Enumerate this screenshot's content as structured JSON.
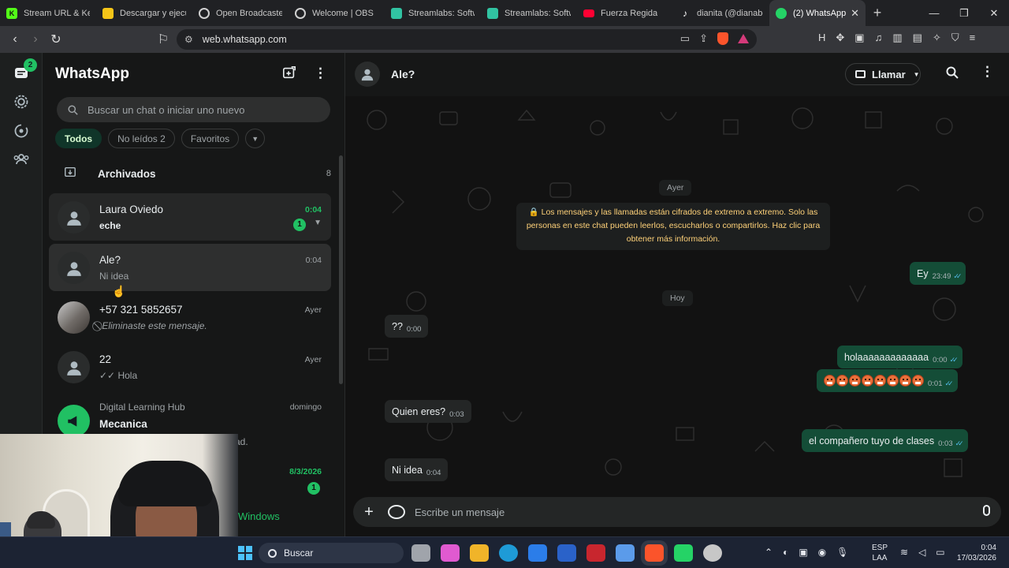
{
  "browser": {
    "tabs": [
      {
        "label": "Stream URL & Key",
        "favicon": "kick-icon",
        "color": "#53fc18"
      },
      {
        "label": "Descargar y ejecut",
        "favicon": "yellow-app-icon",
        "color": "#f5c518"
      },
      {
        "label": "Open Broadcaster",
        "favicon": "obs-icon",
        "color": "#d0d0d0"
      },
      {
        "label": "Welcome | OBS",
        "favicon": "globe-icon",
        "color": "#d0d0d0"
      },
      {
        "label": "Streamlabs: Softw",
        "favicon": "streamlabs-icon",
        "color": "#31c3a2"
      },
      {
        "label": "Streamlabs: Softw",
        "favicon": "streamlabs-icon",
        "color": "#31c3a2"
      },
      {
        "label": "Fuerza Regida",
        "favicon": "youtube-icon",
        "color": "#ff0033"
      },
      {
        "label": "dianita (@dianabe",
        "favicon": "tiktok-icon",
        "color": "#ffffff"
      },
      {
        "label": "(2) WhatsApp",
        "favicon": "whatsapp-icon",
        "color": "#25d366",
        "active": true
      }
    ],
    "url": "web.whatsapp.com"
  },
  "rail": {
    "chats_badge": "2"
  },
  "sidebar": {
    "title": "WhatsApp",
    "search_placeholder": "Buscar un chat o iniciar uno nuevo",
    "filters": [
      "Todos",
      "No leídos 2",
      "Favoritos"
    ],
    "archived_label": "Archivados",
    "archived_count": "8",
    "chats": [
      {
        "name": "Laura Oviedo",
        "preview": "echе",
        "time": "0:04",
        "unread": "1"
      },
      {
        "name": "Ale?",
        "preview": "Ni idea",
        "time": "0:04"
      },
      {
        "name": "+57 321 5852657",
        "preview": "Eliminaste este mensaje.",
        "time": "Ayer"
      },
      {
        "name": "22",
        "preview": "✓✓ Hola",
        "time": "Ayer"
      },
      {
        "name": "Digital Learning Hub",
        "subname": "Mecanica",
        "preview": "...ad.",
        "time": "domingo"
      },
      {
        "name": "",
        "preview": "",
        "time": "8/3/2026",
        "unread": "1"
      }
    ]
  },
  "conversation": {
    "contact_name": "Ale?",
    "call_label": "Llamar",
    "date_yesterday": "Ayer",
    "date_today": "Hoy",
    "encryption_notice": "🔒 Los mensajes y las llamadas están cifrados de extremo a extremo. Solo las personas en este chat pueden leerlos, escucharlos o compartirlos. Haz clic para obtener más información.",
    "messages": [
      {
        "dir": "out",
        "text": "Ey",
        "time": "23:49"
      },
      {
        "dir": "in",
        "text": "??",
        "time": "0:00"
      },
      {
        "dir": "out",
        "text": "holaaaaaaaaaaaaa",
        "time": "0:00"
      },
      {
        "dir": "out",
        "text": "",
        "emoji_count": 8,
        "time": "0:01"
      },
      {
        "dir": "in",
        "text": "Quien eres?",
        "time": "0:03"
      },
      {
        "dir": "out",
        "text": "el compañero tuyo de clases",
        "time": "0:03"
      },
      {
        "dir": "in",
        "text": "Ni idea",
        "time": "0:04"
      }
    ],
    "composer_placeholder": "Escribe un mensaje"
  },
  "overlay": {
    "activate_windows": "Windows"
  },
  "taskbar": {
    "search_label": "Buscar",
    "lang_line1": "ESP",
    "lang_line2": "LAA",
    "time": "0:04",
    "date": "17/03/2026",
    "apps": [
      "#a0a4ab",
      "#e05ad0",
      "#f0b429",
      "#1e9bd7",
      "#2b7de9",
      "#2a62c9",
      "#c8262e",
      "#5b9bea",
      "#fb542b",
      "#25d366",
      "#c7c7c7"
    ]
  },
  "colors": {
    "accent": "#21c063",
    "outgoing_bubble": "#144d37",
    "incoming_bubble": "#242626",
    "read_ticks": "#53bdeb"
  }
}
